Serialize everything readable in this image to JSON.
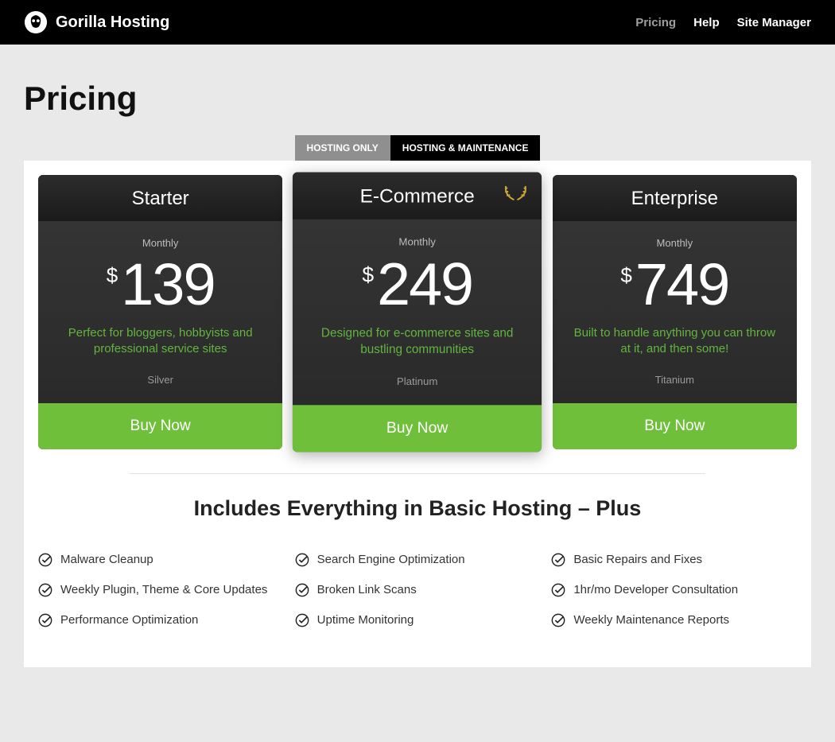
{
  "header": {
    "brand": "Gorilla Hosting",
    "nav": {
      "pricing": "Pricing",
      "help": "Help",
      "site_manager": "Site Manager"
    }
  },
  "page": {
    "title": "Pricing",
    "tabs": {
      "hosting_only": "HOSTING ONLY",
      "hosting_maint": "HOSTING & MAINTENANCE"
    }
  },
  "plans": [
    {
      "name": "Starter",
      "period": "Monthly",
      "currency": "$",
      "amount": "139",
      "desc": "Perfect for bloggers, hobbyists and professional service sites",
      "tier": "Silver",
      "cta": "Buy Now"
    },
    {
      "name": "E-Commerce",
      "period": "Monthly",
      "currency": "$",
      "amount": "249",
      "desc": "Designed for e-commerce sites and bustling communities",
      "tier": "Platinum",
      "cta": "Buy Now"
    },
    {
      "name": "Enterprise",
      "period": "Monthly",
      "currency": "$",
      "amount": "749",
      "desc": "Built to handle anything you can throw at it, and then some!",
      "tier": "Titanium",
      "cta": "Buy Now"
    }
  ],
  "includes": {
    "title": "Includes Everything in Basic Hosting – Plus",
    "features": [
      "Malware Cleanup",
      "Search Engine Optimization",
      "Basic Repairs and Fixes",
      "Weekly Plugin, Theme & Core Updates",
      "Broken Link Scans",
      "1hr/mo Developer Consultation",
      "Performance Optimization",
      "Uptime Monitoring",
      "Weekly Maintenance Reports"
    ]
  }
}
